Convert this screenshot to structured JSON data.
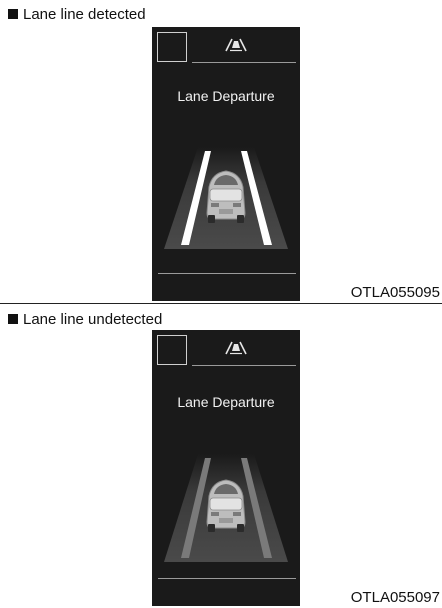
{
  "panels": [
    {
      "caption": "Lane line detected",
      "cluster_title": "Lane Departure",
      "figure_code": "OTLA055095",
      "lane_lines_state": "detected"
    },
    {
      "caption": "Lane line undetected",
      "cluster_title": "Lane Departure",
      "figure_code": "OTLA055097",
      "lane_lines_state": "undetected"
    }
  ],
  "colors": {
    "cluster_bg": "#1a1a1a",
    "lane_line_detected": "#ffffff",
    "lane_line_undetected": "#7a7a7a"
  }
}
